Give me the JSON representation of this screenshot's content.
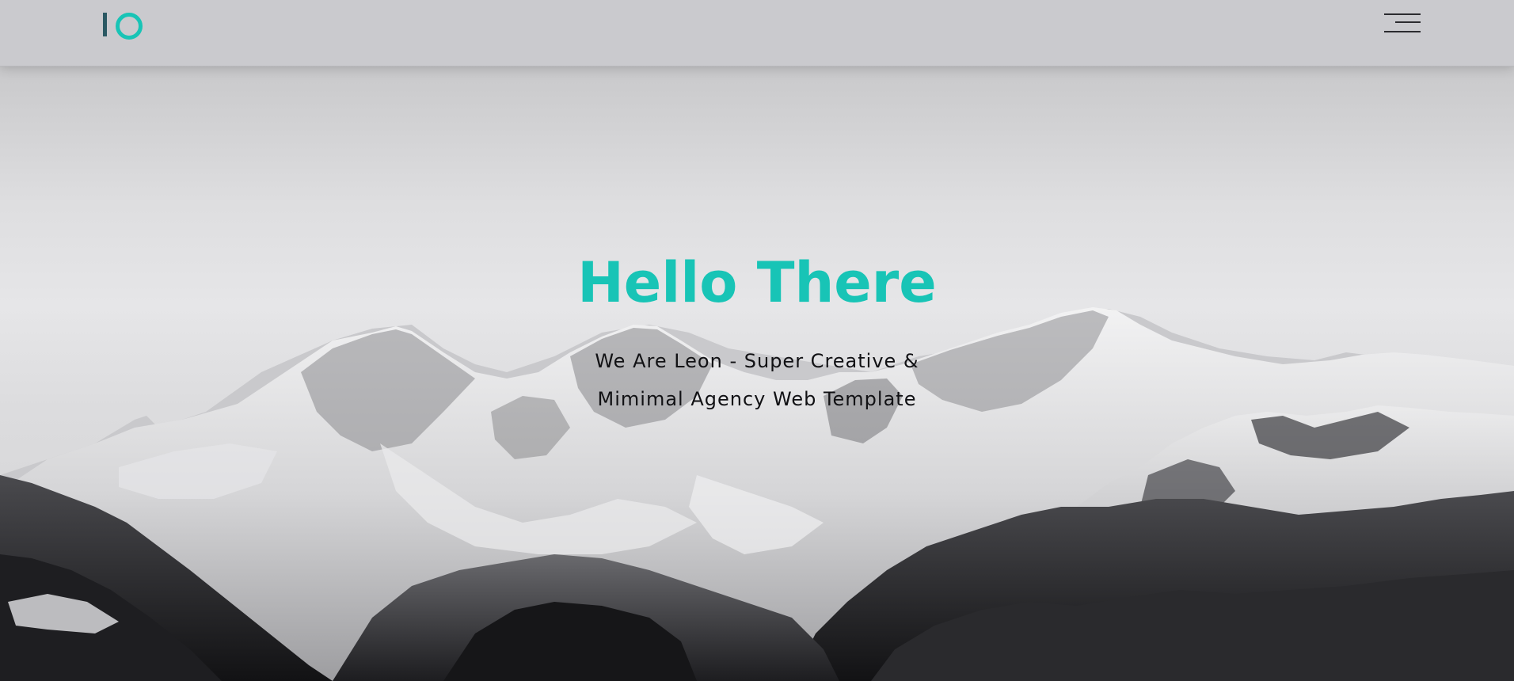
{
  "header": {
    "logo_icon": "io-logo-icon",
    "menu_icon": "hamburger-menu-icon"
  },
  "hero": {
    "title": "Hello There",
    "subtitle_line1": "We Are Leon - Super Creative &",
    "subtitle_line2": "Mimimal Agency Web Template",
    "background": "snowy-mountains-photo"
  },
  "colors": {
    "accent": "#18c4b6",
    "logo_bar": "#2a5863",
    "header_bg": "#cacace",
    "text_dark": "#111114"
  }
}
